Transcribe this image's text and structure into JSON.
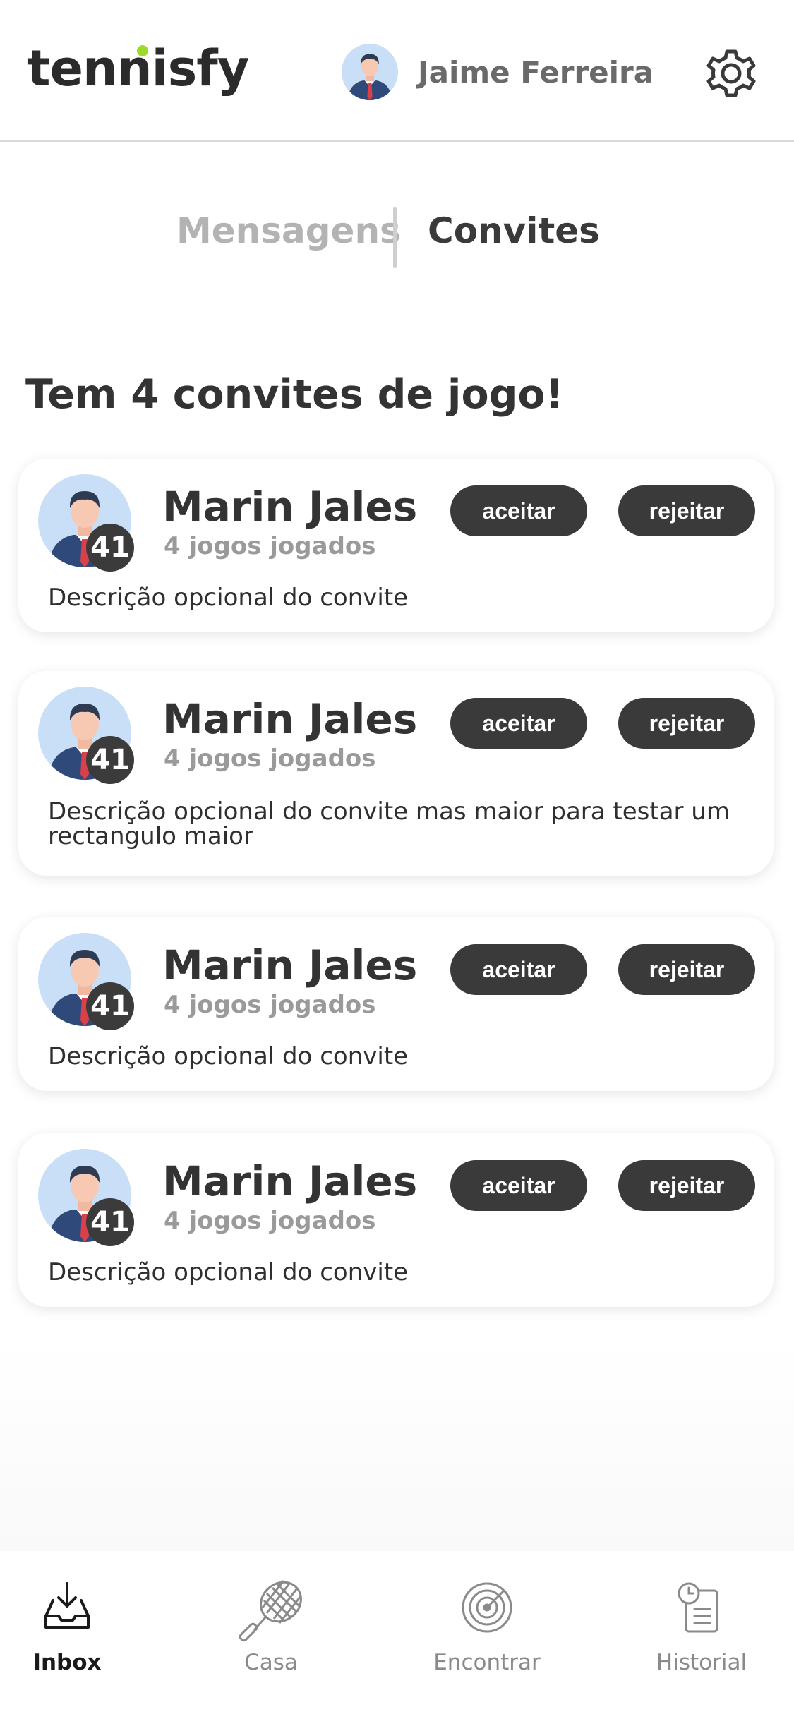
{
  "header": {
    "logo": "tennisfy",
    "user_name": "Jaime Ferreira",
    "icons": {
      "avatar": "user-avatar",
      "settings": "gear-icon"
    }
  },
  "tabs": [
    {
      "label": "Mensagens",
      "active": false
    },
    {
      "label": "Convites",
      "active": true
    }
  ],
  "main": {
    "title": "Tem 4 convites de jogo!",
    "invites": [
      {
        "name": "Marin Jales",
        "games": "4 jogos jogados",
        "level": "41",
        "accept": "aceitar",
        "reject": "rejeitar",
        "description": "Descrição opcional do convite"
      },
      {
        "name": "Marin Jales",
        "games": "4 jogos jogados",
        "level": "41",
        "accept": "aceitar",
        "reject": "rejeitar",
        "description": "Descrição opcional do convite mas maior para testar um rectangulo maior"
      },
      {
        "name": "Marin Jales",
        "games": "4 jogos jogados",
        "level": "41",
        "accept": "aceitar",
        "reject": "rejeitar",
        "description": "Descrição opcional do convite"
      },
      {
        "name": "Marin Jales",
        "games": "4 jogos jogados",
        "level": "41",
        "accept": "aceitar",
        "reject": "rejeitar",
        "description": "Descrição opcional do convite"
      }
    ]
  },
  "bottom_nav": [
    {
      "label": "Inbox",
      "icon": "inbox-icon",
      "active": true
    },
    {
      "label": "Casa",
      "icon": "tennis-racket-icon",
      "active": false
    },
    {
      "label": "Encontrar",
      "icon": "radar-icon",
      "active": false
    },
    {
      "label": "Historial",
      "icon": "history-icon",
      "active": false
    }
  ],
  "colors": {
    "accent_dot": "#9bdc28",
    "button": "#3a3a3a",
    "text_primary": "#333333",
    "text_muted": "#9a9a9a"
  }
}
